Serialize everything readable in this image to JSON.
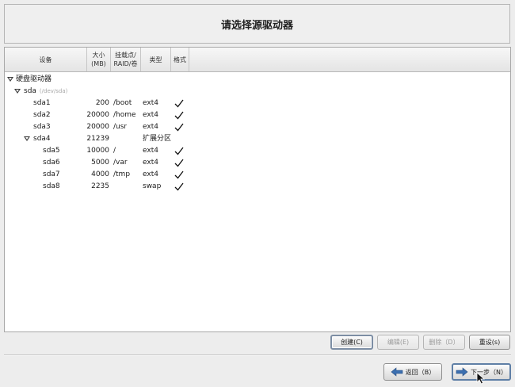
{
  "header": {
    "title": "请选择源驱动器"
  },
  "columns": {
    "device": "设备",
    "size": "大小\n(MB)",
    "mount": "挂载点/\nRAID/卷",
    "type": "类型",
    "format": "格式"
  },
  "tree": {
    "root_label": "硬盘驱动器",
    "disk": {
      "label": "sda",
      "path": "(/dev/sda)"
    },
    "rows": [
      {
        "device": "sda1",
        "size": "200",
        "mount": "/boot",
        "type": "ext4",
        "format": true
      },
      {
        "device": "sda2",
        "size": "20000",
        "mount": "/home",
        "type": "ext4",
        "format": true
      },
      {
        "device": "sda3",
        "size": "20000",
        "mount": "/usr",
        "type": "ext4",
        "format": true
      },
      {
        "device": "sda4",
        "size": "21239",
        "mount": "",
        "type": "扩展分区",
        "format": false
      },
      {
        "device": "sda5",
        "size": "10000",
        "mount": "/",
        "type": "ext4",
        "format": true
      },
      {
        "device": "sda6",
        "size": "5000",
        "mount": "/var",
        "type": "ext4",
        "format": true
      },
      {
        "device": "sda7",
        "size": "4000",
        "mount": "/tmp",
        "type": "ext4",
        "format": true
      },
      {
        "device": "sda8",
        "size": "2235",
        "mount": "",
        "type": "swap",
        "format": true
      }
    ]
  },
  "actions": {
    "create": "创建(C)",
    "edit": "编辑(E)",
    "delete": "删除（D）",
    "reset": "重设(s)"
  },
  "nav": {
    "back": "返回（B）",
    "next": "下一步（N）"
  },
  "icons": {
    "expander": "triangle-down-icon",
    "format_mark": "checkmark-icon",
    "back": "arrow-left-icon",
    "next": "arrow-right-icon",
    "cursor": "mouse-pointer-icon"
  },
  "colors": {
    "background": "#ededed",
    "panel": "#ffffff",
    "arrow_blue": "#3b6fb0"
  }
}
